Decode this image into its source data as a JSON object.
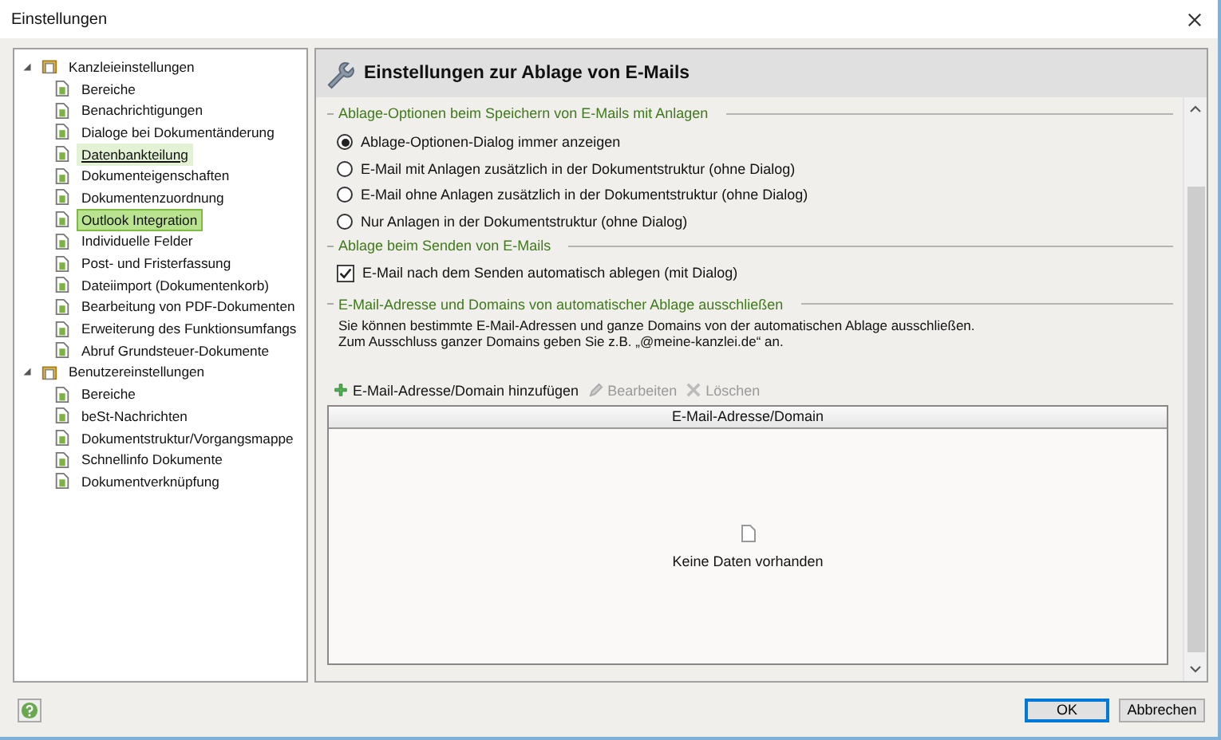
{
  "window": {
    "title": "Einstellungen"
  },
  "tree": [
    {
      "label": "Kanzleieinstellungen",
      "expanded": true,
      "children": [
        {
          "label": "Bereiche",
          "selected": false,
          "hovered": false
        },
        {
          "label": "Benachrichtigungen",
          "selected": false,
          "hovered": false
        },
        {
          "label": "Dialoge bei Dokumentänderung",
          "selected": false,
          "hovered": false
        },
        {
          "label": "Datenbankteilung",
          "selected": false,
          "hovered": true
        },
        {
          "label": "Dokumenteigenschaften",
          "selected": false,
          "hovered": false
        },
        {
          "label": "Dokumentenzuordnung",
          "selected": false,
          "hovered": false
        },
        {
          "label": "Outlook Integration",
          "selected": true,
          "hovered": false
        },
        {
          "label": "Individuelle Felder",
          "selected": false,
          "hovered": false
        },
        {
          "label": "Post- und Fristerfassung",
          "selected": false,
          "hovered": false
        },
        {
          "label": "Dateiimport (Dokumentenkorb)",
          "selected": false,
          "hovered": false
        },
        {
          "label": "Bearbeitung von PDF-Dokumenten",
          "selected": false,
          "hovered": false
        },
        {
          "label": "Erweiterung des Funktionsumfangs",
          "selected": false,
          "hovered": false
        },
        {
          "label": "Abruf Grundsteuer-Dokumente",
          "selected": false,
          "hovered": false
        }
      ]
    },
    {
      "label": "Benutzereinstellungen",
      "expanded": true,
      "children": [
        {
          "label": "Bereiche",
          "selected": false,
          "hovered": false
        },
        {
          "label": "beSt-Nachrichten",
          "selected": false,
          "hovered": false
        },
        {
          "label": "Dokumentstruktur/Vorgangsmappe",
          "selected": false,
          "hovered": false
        },
        {
          "label": "Schnellinfo Dokumente",
          "selected": false,
          "hovered": false
        },
        {
          "label": "Dokumentverknüpfung",
          "selected": false,
          "hovered": false
        }
      ]
    }
  ],
  "panel": {
    "title": "Einstellungen zur Ablage von E-Mails",
    "groups": [
      {
        "title": "Ablage-Optionen beim Speichern von E-Mails mit Anlagen",
        "items": [
          {
            "kind": "radio",
            "label": "Ablage-Optionen-Dialog immer anzeigen",
            "selected": true
          },
          {
            "kind": "radio",
            "label": "E-Mail mit Anlagen zusätzlich in der Dokumentstruktur (ohne Dialog)",
            "selected": false
          },
          {
            "kind": "radio",
            "label": "E-Mail ohne Anlagen zusätzlich in der Dokumentstruktur (ohne Dialog)",
            "selected": false
          },
          {
            "kind": "radio",
            "label": "Nur Anlagen in der Dokumentstruktur (ohne Dialog)",
            "selected": false
          }
        ]
      },
      {
        "title": "Ablage beim Senden von E-Mails",
        "items": [
          {
            "kind": "checkbox",
            "label": "E-Mail nach dem Senden automatisch ablegen (mit Dialog)",
            "checked": true
          }
        ]
      },
      {
        "title": "E-Mail-Adresse und Domains von automatischer Ablage ausschließen",
        "items": [
          {
            "kind": "text",
            "lines": [
              "Sie können bestimmte E-Mail-Adressen und ganze Domains von der automatischen Ablage ausschließen.",
              "Zum Ausschluss ganzer Domains geben Sie z.B. „@meine-kanzlei.de“ an."
            ]
          }
        ]
      }
    ],
    "toolbar": [
      {
        "kind": "add",
        "label": "E-Mail-Adresse/Domain hinzufügen",
        "disabled": false
      },
      {
        "kind": "edit",
        "label": "Bearbeiten",
        "disabled": true
      },
      {
        "kind": "delete",
        "label": "Löschen",
        "disabled": true
      }
    ],
    "table": {
      "columns": [
        "E-Mail-Adresse/Domain"
      ],
      "empty_text": "Keine Daten vorhanden"
    }
  },
  "buttons": [
    {
      "label": "OK",
      "default": true
    },
    {
      "label": "Abbrechen",
      "default": false
    }
  ]
}
